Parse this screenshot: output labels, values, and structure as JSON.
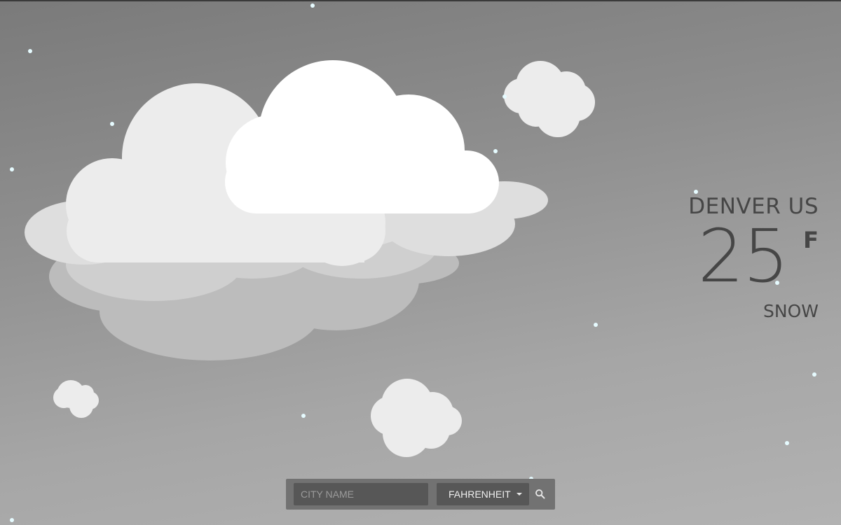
{
  "weather": {
    "city": "DENVER US",
    "temperature": "25",
    "unit_symbol": "F",
    "condition": "SNOW"
  },
  "controls": {
    "city_placeholder": "CITY NAME",
    "unit_selected": "FAHRENHEIT",
    "search_icon": "search-icon"
  },
  "colors": {
    "text": "#464646",
    "cloud_front": "#ffffff",
    "cloud_back": "#ececec",
    "snowflake": "#e6fbff"
  }
}
